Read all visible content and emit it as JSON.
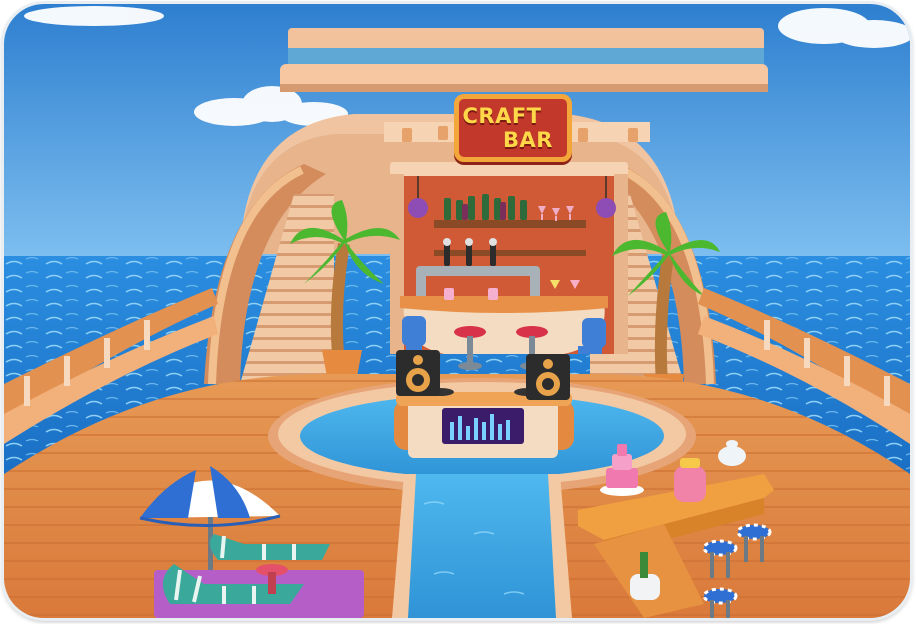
{
  "sign": {
    "line1": "CRAFT",
    "line2": "BAR"
  },
  "colors": {
    "sky": "#3f8ed8",
    "sea": "#1f86d6",
    "deck": "#e48a43",
    "hull": "#f0b98b",
    "sign_red": "#c2392b",
    "sign_text": "#ffd84a",
    "pool_water": "#5bc5f0",
    "bar_wall": "#c64a2c"
  },
  "scene_objects": [
    "craft-bar-sign",
    "bottle-shelf",
    "beer-taps",
    "bar-counter",
    "bar-stools",
    "palm-trees",
    "staircases",
    "dj-booth",
    "speakers",
    "pool",
    "beach-umbrella",
    "sun-loungers",
    "cake-table",
    "side-stools"
  ]
}
